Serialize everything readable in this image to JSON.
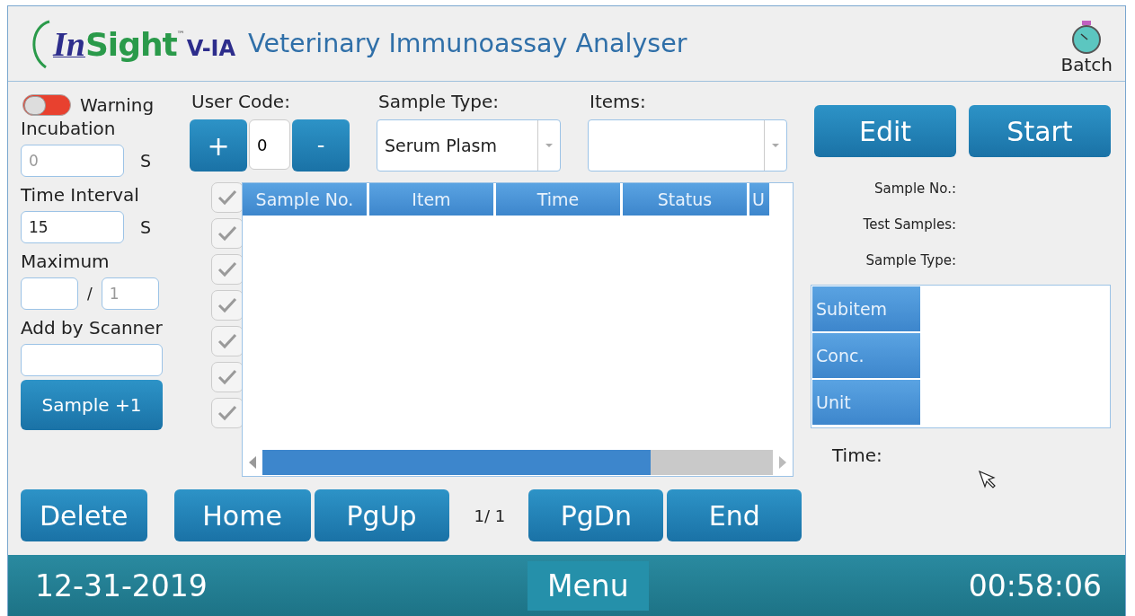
{
  "header": {
    "logo": {
      "prefix": "In",
      "name": "Sight",
      "mark": "™",
      "model": "V-IA"
    },
    "title": "Veterinary Immunoassay Analyser",
    "batch_label": "Batch"
  },
  "left": {
    "warning": {
      "label": "Warning",
      "on": false
    },
    "incubation": {
      "label": "Incubation",
      "placeholder": "0",
      "unit": "S"
    },
    "time_interval": {
      "label": "Time Interval",
      "value": "15",
      "unit": "S"
    },
    "maximum": {
      "label": "Maximum",
      "separator": "/",
      "placeholder": "1"
    },
    "scanner": {
      "label": "Add by Scanner"
    },
    "sample_button": "Sample +1"
  },
  "user_code": {
    "label": "User Code:",
    "plus": "+",
    "value": "0",
    "minus": "-"
  },
  "sample_type": {
    "label": "Sample Type:",
    "value": "Serum Plasm"
  },
  "items": {
    "label": "Items:"
  },
  "row_checks": [
    {
      "checked": true,
      "disabled": true
    },
    {
      "checked": true,
      "disabled": true
    },
    {
      "checked": true,
      "disabled": true
    },
    {
      "checked": true,
      "disabled": true
    },
    {
      "checked": true,
      "disabled": true
    },
    {
      "checked": true,
      "disabled": true
    },
    {
      "checked": true,
      "disabled": true
    }
  ],
  "table": {
    "columns": [
      "Sample No.",
      "Item",
      "Time",
      "Status",
      "U"
    ]
  },
  "nav": {
    "delete": "Delete",
    "buttons": [
      "Home",
      "PgUp"
    ],
    "page": "1/ 1",
    "buttons2": [
      "PgDn",
      "End"
    ]
  },
  "right": {
    "buttons": [
      "Edit",
      "Start"
    ],
    "info": [
      "Sample No.:",
      "Test Samples:",
      "Sample Type:"
    ],
    "result_rows": [
      "Subitem",
      "Conc.",
      "Unit"
    ],
    "time_label": "Time:"
  },
  "status_bar": {
    "date": "12-31-2019",
    "menu": "Menu",
    "time": "00:58:06"
  }
}
